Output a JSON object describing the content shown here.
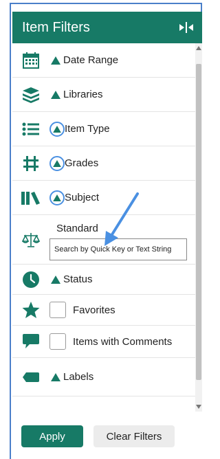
{
  "panel": {
    "title": "Item Filters",
    "collapse_icon": "collapse-panel-icon",
    "colors": {
      "header_bg": "#177a66",
      "accent": "#177a66",
      "annotation": "#4a90e2"
    }
  },
  "filters": [
    {
      "label": "Date Range",
      "icon": "calendar-icon"
    },
    {
      "label": "Libraries",
      "icon": "books-stack-icon"
    },
    {
      "label": "Item Type",
      "icon": "list-icon"
    },
    {
      "label": "Grades",
      "icon": "hash-grid-icon"
    },
    {
      "label": "Subject",
      "icon": "library-shelf-icon"
    },
    {
      "label": "Standard",
      "icon": "scales-icon",
      "search_placeholder": "Search by Quick Key or Text String"
    },
    {
      "label": "Status",
      "icon": "clock-icon"
    },
    {
      "label": "Favorites",
      "icon": "star-icon"
    },
    {
      "label": "Items with Comments",
      "icon": "comment-icon"
    },
    {
      "label": "Labels",
      "icon": "tag-icon"
    }
  ],
  "footer": {
    "apply_label": "Apply",
    "clear_label": "Clear Filters"
  }
}
